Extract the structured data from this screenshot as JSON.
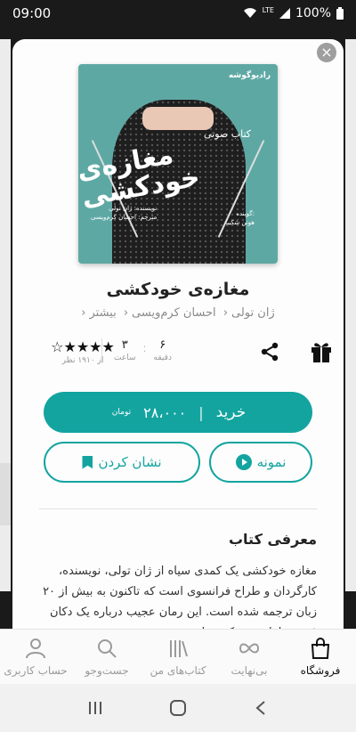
{
  "status": {
    "time": "09:00",
    "network": "LTE",
    "battery": "100%"
  },
  "book": {
    "cover": {
      "publisher": "رادیوگوشه",
      "title_small": "کتاب صوتی",
      "title_big": "مغازه‌ی خودکشی",
      "credit_author": "نویسنده: ژان تولی",
      "credit_translator": "مترجم: احسان کرم‌ویسی",
      "credit_narrator_label": "گوینده:",
      "credit_narrator": "هوتن شکیبا"
    },
    "title": "مغازه‌ی خودکشی",
    "author": "ژان تولی",
    "translator": "احسان کرم‌ویسی",
    "more": "بیشتر",
    "duration_minutes": "۶",
    "duration_minutes_label": "دقیقه",
    "duration_hours": "۳",
    "duration_hours_label": "ساعت",
    "rating_stars": "★★★★",
    "rating_empty": "☆",
    "rating_count": "از ۱۹۱۰ نظر"
  },
  "actions": {
    "buy_label": "خرید",
    "separator": "|",
    "price": "۲۸،۰۰۰",
    "currency": "تومان",
    "sample_label": "نمونه",
    "bookmark_label": "نشان کردن"
  },
  "intro": {
    "title": "معرفی کتاب",
    "text": "مغازه خودکشی یک کمدی سیاه از ژان تولی، نویسنده، کارگردان و طراح فرانسوی است که تاکنون به بیش از ۲۰ زبان ترجمه شده است. این رمان عجیب درباره یک دکان فروش لوازم خودکشی است"
  },
  "tabs": [
    {
      "label": "فروشگاه",
      "icon": "bag-icon",
      "active": true
    },
    {
      "label": "بی‌نهایت",
      "icon": "infinity-icon",
      "active": false
    },
    {
      "label": "کتاب‌های من",
      "icon": "books-icon",
      "active": false
    },
    {
      "label": "جست‌وجو",
      "icon": "search-icon",
      "active": false
    },
    {
      "label": "حساب کاربری",
      "icon": "user-icon",
      "active": false
    }
  ],
  "colors": {
    "accent": "#13a4a0"
  }
}
